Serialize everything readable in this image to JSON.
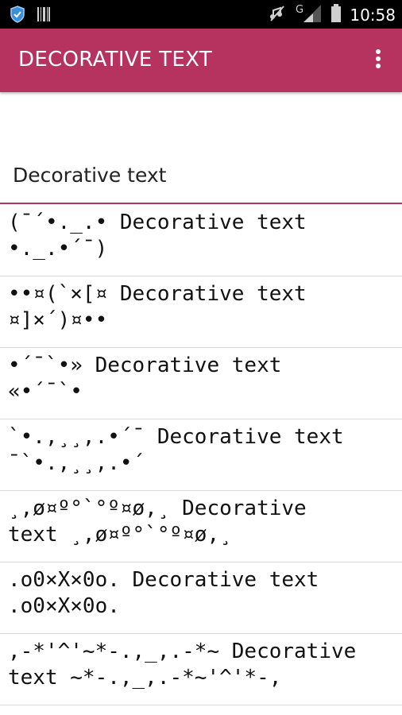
{
  "status_bar": {
    "time": "10:58",
    "icons": [
      "shield-icon",
      "barcode-icon",
      "mute-icon",
      "signal-icon",
      "battery-icon"
    ]
  },
  "app_bar": {
    "title": "DECORATIVE TEXT",
    "menu_icon": "overflow-menu-icon",
    "color": "#b5335e"
  },
  "input": {
    "value": "Decorative text",
    "underline_color": "#b5335e"
  },
  "items": [
    "(¯´•._.• Decorative text\n•._.•´¯)",
    "••¤(`×[¤ Decorative text\n¤]×´)¤••",
    "•´¯`•» Decorative text\n«•´¯`•",
    "`•.,¸¸,.•´¯ Decorative text\n¯`•.,¸¸,.•´",
    "¸,ø¤º°`°º¤ø,¸ Decorative\ntext ¸,ø¤º°`°º¤ø,¸",
    ".o0×X×0o. Decorative text\n.o0×X×0o.",
    ",-*'^'~*-.,_,.-*~ Decorative\ntext ~*-.,_,.-*~'^'*-,"
  ]
}
